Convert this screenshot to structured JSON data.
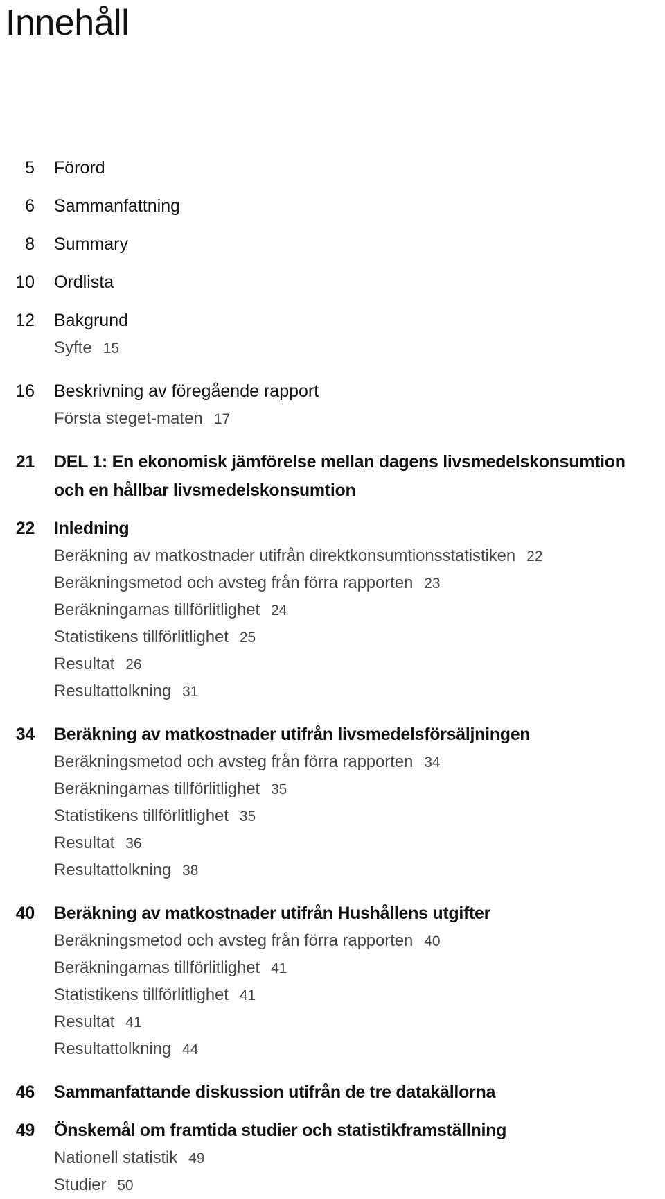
{
  "document": {
    "title": "Innehåll",
    "language": "sv"
  },
  "toc": {
    "entries": [
      {
        "page": "5",
        "title": "Förord",
        "style": "plain",
        "subs": []
      },
      {
        "page": "6",
        "title": "Sammanfattning",
        "style": "plain",
        "subs": []
      },
      {
        "page": "8",
        "title": "Summary",
        "style": "plain",
        "subs": []
      },
      {
        "page": "10",
        "title": "Ordlista",
        "style": "plain",
        "subs": []
      },
      {
        "page": "12",
        "title": "Bakgrund",
        "style": "plain",
        "subs": [
          {
            "label": "Syfte",
            "page": "15"
          }
        ]
      },
      {
        "page": "16",
        "title": "Beskrivning av föregående rapport",
        "style": "plain",
        "subs": [
          {
            "label": "Första steget-maten",
            "page": "17"
          }
        ]
      },
      {
        "page": "21",
        "title": "DEL 1: En ekonomisk jämförelse mellan dagens livsmedelskonsumtion",
        "title_cont": "och en hållbar livsmedelskonsumtion",
        "style": "narrow",
        "subs": []
      },
      {
        "page": "22",
        "title": "Inledning",
        "style": "narrow",
        "subs": [
          {
            "label": "Beräkning av matkostnader utifrån direktkonsumtionsstatistiken",
            "page": "22"
          },
          {
            "label": "Beräkningsmetod och avsteg från förra rapporten",
            "page": "23"
          },
          {
            "label": "Beräkningarnas tillförlitlighet",
            "page": "24"
          },
          {
            "label": "Statistikens tillförlitlighet",
            "page": "25"
          },
          {
            "label": "Resultat",
            "page": "26"
          },
          {
            "label": "Resultattolkning",
            "page": "31"
          }
        ]
      },
      {
        "page": "34",
        "title": "Beräkning av matkostnader utifrån livsmedelsförsäljningen",
        "style": "narrow",
        "subs": [
          {
            "label": "Beräkningsmetod och avsteg från förra rapporten",
            "page": "34"
          },
          {
            "label": "Beräkningarnas tillförlitlighet",
            "page": "35"
          },
          {
            "label": "Statistikens tillförlitlighet",
            "page": "35"
          },
          {
            "label": "Resultat",
            "page": "36"
          },
          {
            "label": "Resultattolkning",
            "page": "38"
          }
        ]
      },
      {
        "page": "40",
        "title": "Beräkning av matkostnader utifrån Hushållens utgifter",
        "style": "narrow",
        "subs": [
          {
            "label": "Beräkningsmetod och avsteg från förra rapporten",
            "page": "40"
          },
          {
            "label": "Beräkningarnas tillförlitlighet",
            "page": "41"
          },
          {
            "label": "Statistikens tillförlitlighet",
            "page": "41"
          },
          {
            "label": "Resultat",
            "page": "41"
          },
          {
            "label": "Resultattolkning",
            "page": "44"
          }
        ]
      },
      {
        "page": "46",
        "title": "Sammanfattande diskussion utifrån de tre datakällorna",
        "style": "narrow",
        "subs": []
      },
      {
        "page": "49",
        "title": "Önskemål om framtida studier och statistikframställning",
        "style": "narrow",
        "subs": [
          {
            "label": "Nationell statistik",
            "page": "49"
          },
          {
            "label": "Studier",
            "page": "50"
          }
        ]
      }
    ]
  }
}
